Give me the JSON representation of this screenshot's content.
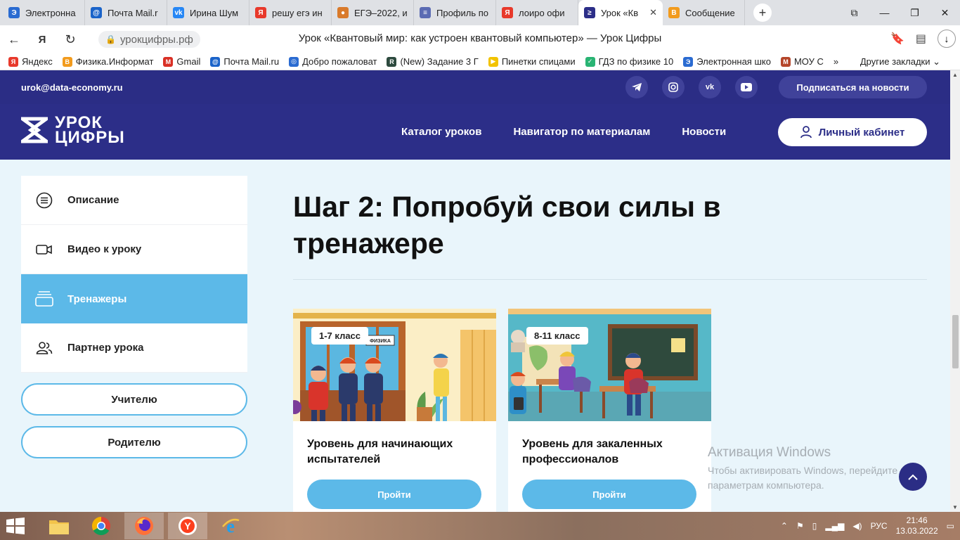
{
  "browser": {
    "tabs": [
      {
        "title": "Электронна",
        "color": "#2a6bd1",
        "glyph": "Э"
      },
      {
        "title": "Почта Mail.r",
        "color": "#1a63c9",
        "glyph": "@"
      },
      {
        "title": "Ирина Шум",
        "color": "#2787f5",
        "glyph": "vk"
      },
      {
        "title": "решу егэ ин",
        "color": "#e8392b",
        "glyph": "Я"
      },
      {
        "title": "ЕГЭ–2022, и",
        "color": "#d97a2b",
        "glyph": "●"
      },
      {
        "title": "Профиль по",
        "color": "#5b6bb3",
        "glyph": "≡"
      },
      {
        "title": "лоиро офи",
        "color": "#e8392b",
        "glyph": "Я"
      },
      {
        "title": "Урок «Кв",
        "color": "#2c2e88",
        "glyph": "≥",
        "active": true
      },
      {
        "title": "Сообщение",
        "color": "#f29b1d",
        "glyph": "B"
      }
    ],
    "url": "урокцифры.рф",
    "page_title": "Урок «Квантовый мир: как устроен квантовый компьютер» — Урок Цифры",
    "bookmarks": [
      {
        "label": "Яндекс",
        "color": "#e8392b",
        "glyph": "Я"
      },
      {
        "label": "Физика.Информат",
        "color": "#f29b1d",
        "glyph": "B"
      },
      {
        "label": "Gmail",
        "color": "#d93025",
        "glyph": "M"
      },
      {
        "label": "Почта Mail.ru",
        "color": "#1a63c9",
        "glyph": "@"
      },
      {
        "label": "Добро пожаловат",
        "color": "#2a6bd1",
        "glyph": "◎"
      },
      {
        "label": "(New) Задание 3 Г",
        "color": "#2d4a3e",
        "glyph": "R"
      },
      {
        "label": "Пинетки спицами",
        "color": "#f2c300",
        "glyph": "▶"
      },
      {
        "label": "ГДЗ по физике 10",
        "color": "#29b473",
        "glyph": "✓"
      },
      {
        "label": "Электронная шко",
        "color": "#2a6bd1",
        "glyph": "Э"
      },
      {
        "label": "МОУ С",
        "color": "#b5462a",
        "glyph": "М"
      }
    ],
    "bookmarks_more": "»",
    "other_bookmarks": "Другие закладки"
  },
  "site": {
    "email": "urok@data-economy.ru",
    "socials": [
      "telegram-icon",
      "instagram-icon",
      "vk-icon",
      "youtube-icon"
    ],
    "subscribe": "Подписаться на новости",
    "logo_line1": "УРОК",
    "logo_line2": "ЦИФРЫ",
    "nav": [
      "Каталог уроков",
      "Навигатор по материалам",
      "Новости"
    ],
    "cabinet": "Личный кабинет"
  },
  "sidebar": {
    "items": [
      {
        "label": "Описание",
        "icon": "list-icon"
      },
      {
        "label": "Видео к уроку",
        "icon": "video-icon"
      },
      {
        "label": "Тренажеры",
        "icon": "stack-icon",
        "active": true
      },
      {
        "label": "Партнер урока",
        "icon": "people-icon"
      }
    ],
    "teacher": "Учителю",
    "parent": "Родителю"
  },
  "main": {
    "heading": "Шаг 2: Попробуй свои силы в тренажере",
    "cards": [
      {
        "badge": "1-7 класс",
        "title": "Уровень для начинающих испытателей",
        "button": "Пройти",
        "sign": "ФИЗИКА"
      },
      {
        "badge": "8-11 класс",
        "title": "Уровень для закаленных профессионалов",
        "button": "Пройти"
      }
    ]
  },
  "watermark": {
    "title": "Активация Windows",
    "line1": "Чтобы активировать Windows, перейдите к",
    "line2": "параметрам компьютера."
  },
  "taskbar": {
    "lang": "РУС",
    "time": "21:46",
    "date": "13.03.2022"
  },
  "colors": {
    "brand": "#2c2e88",
    "accent": "#5cb9e8"
  }
}
